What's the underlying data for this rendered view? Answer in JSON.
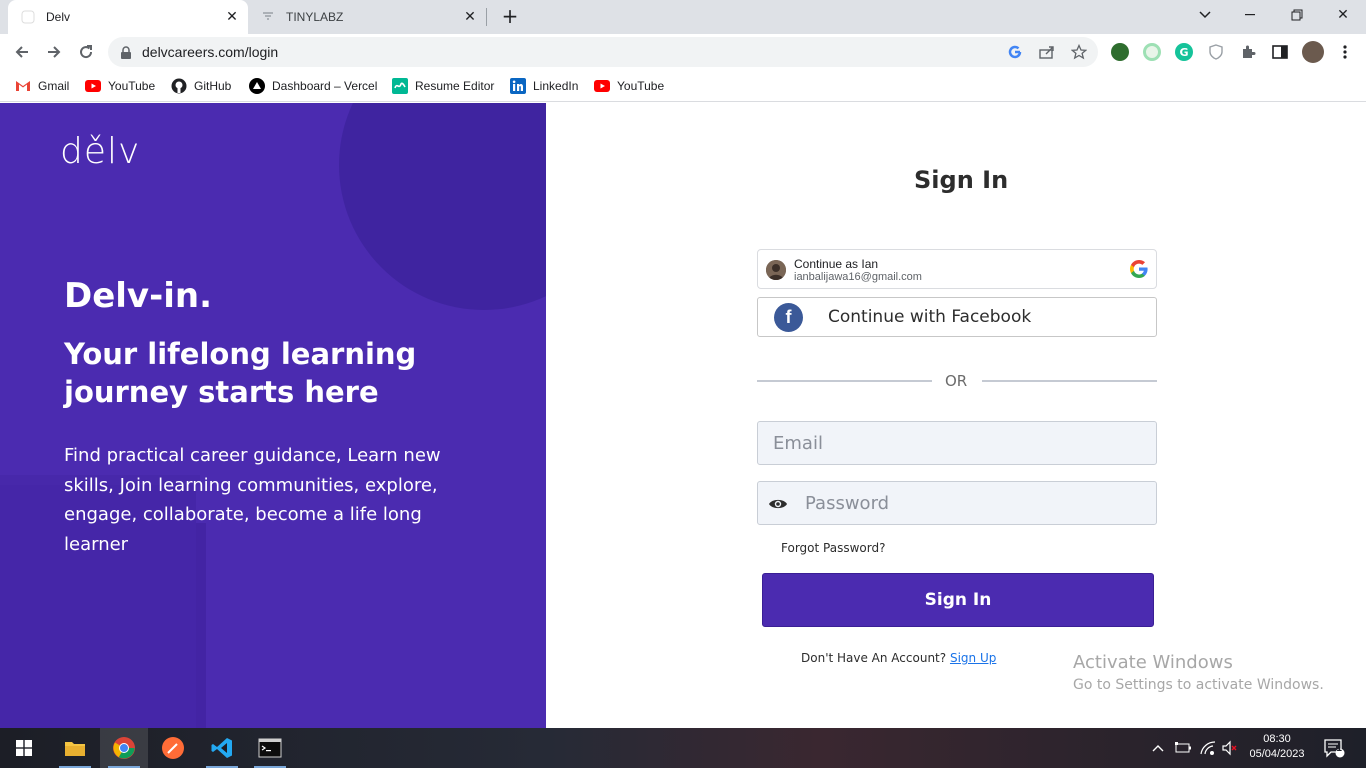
{
  "browser": {
    "tabs": [
      {
        "title": "Delv",
        "active": true
      },
      {
        "title": "TINYLABZ",
        "active": false
      }
    ],
    "url": "delvcareers.com/login",
    "bookmarks": [
      {
        "label": "Gmail",
        "icon": "gmail-icon"
      },
      {
        "label": "YouTube",
        "icon": "youtube-icon"
      },
      {
        "label": "GitHub",
        "icon": "github-icon"
      },
      {
        "label": "Dashboard – Vercel",
        "icon": "vercel-icon"
      },
      {
        "label": "Resume Editor",
        "icon": "resume-editor-icon"
      },
      {
        "label": "LinkedIn",
        "icon": "linkedin-icon"
      },
      {
        "label": "YouTube",
        "icon": "youtube-icon"
      }
    ]
  },
  "hero": {
    "logo": "dělv",
    "headline": "Delv-in.",
    "subheadline": "Your lifelong learning journey starts here",
    "description": "Find practical career guidance, Learn new skills, Join learning communities, explore, engage, collaborate, become a life long learner"
  },
  "signin": {
    "title": "Sign In",
    "google": {
      "name": "Continue as Ian",
      "email": "ianbalijawa16@gmail.com"
    },
    "facebook_label": "Continue with Facebook",
    "divider": "OR",
    "email_placeholder": "Email",
    "password_placeholder": "Password",
    "forgot": "Forgot Password?",
    "submit": "Sign In",
    "no_account": "Don't Have An Account?",
    "signup_link": "Sign Up"
  },
  "watermark": {
    "line1": "Activate Windows",
    "line2": "Go to Settings to activate Windows."
  },
  "taskbar": {
    "time": "08:30",
    "date": "05/04/2023",
    "notifications": "1"
  },
  "colors": {
    "brand_purple": "#4b2bb0",
    "facebook_blue": "#3b5998"
  }
}
